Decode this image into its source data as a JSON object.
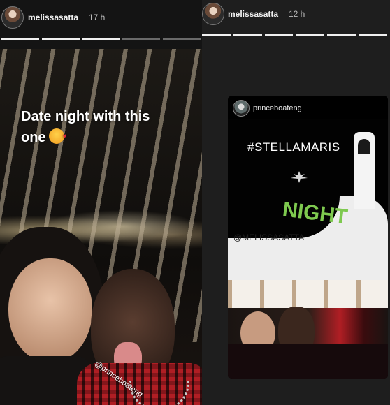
{
  "left_story": {
    "username": "melissasatta",
    "time": "17 h",
    "progress_total": 5,
    "progress_seen": 3,
    "caption_line1": "Date night with this",
    "caption_line2": "one",
    "emoji": "smiling face with hearts",
    "mention_sticker": "@princeboateng"
  },
  "right_story": {
    "username": "melissasatta",
    "time": "12 h",
    "progress_total": 6,
    "progress_seen": 6,
    "embedded_post": {
      "author": "princeboateng",
      "hashtag": "#STELLAMARIS",
      "night_text": "NIGHT",
      "mention": "@MELISSASATTA"
    }
  },
  "colors": {
    "background": "#1c1c1c",
    "night_green": "#7ec94f",
    "shirt_red": "#b01e24"
  },
  "icons": [
    "avatar",
    "progress-bar"
  ]
}
